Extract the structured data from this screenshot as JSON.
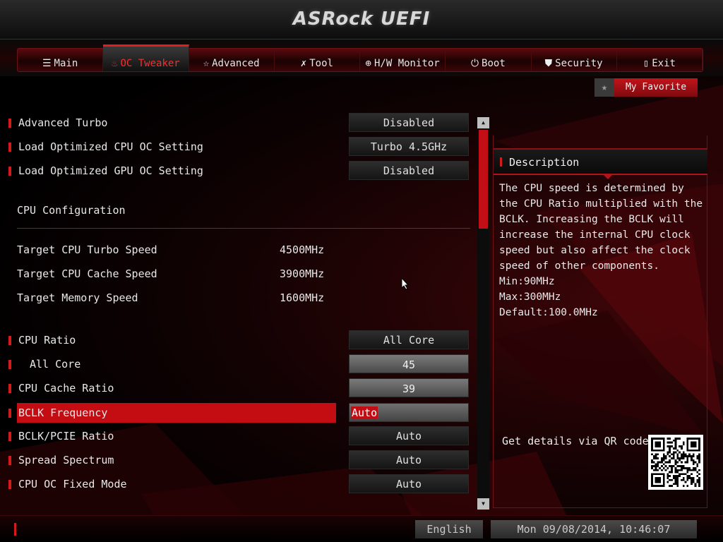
{
  "header": {
    "title": "ASRock UEFI"
  },
  "nav": {
    "tabs": [
      {
        "label": "Main",
        "icon": "list-icon",
        "glyph": "☰",
        "active": false
      },
      {
        "label": "OC Tweaker",
        "icon": "flame-icon",
        "glyph": "♨",
        "active": true
      },
      {
        "label": "Advanced",
        "icon": "star-icon",
        "glyph": "☆",
        "active": false
      },
      {
        "label": "Tool",
        "icon": "tools-icon",
        "glyph": "✗",
        "active": false
      },
      {
        "label": "H/W Monitor",
        "icon": "monitor-icon",
        "glyph": "⊕",
        "active": false
      },
      {
        "label": "Boot",
        "icon": "power-icon",
        "glyph": "⏻",
        "active": false
      },
      {
        "label": "Security",
        "icon": "shield-icon",
        "glyph": "⛊",
        "active": false
      },
      {
        "label": "Exit",
        "icon": "exit-icon",
        "glyph": "▯",
        "active": false
      }
    ]
  },
  "favorite": {
    "label": "My Favorite",
    "icon": "star-icon"
  },
  "settings": {
    "advanced_turbo": {
      "label": "Advanced Turbo",
      "value": "Disabled"
    },
    "load_cpu_oc": {
      "label": "Load Optimized CPU OC Setting",
      "value": "Turbo 4.5GHz"
    },
    "load_gpu_oc": {
      "label": "Load Optimized GPU OC Setting",
      "value": "Disabled"
    },
    "cpu_config_heading": "CPU Configuration",
    "target_turbo": {
      "label": "Target CPU Turbo Speed",
      "value": "4500MHz"
    },
    "target_cache": {
      "label": "Target CPU Cache Speed",
      "value": "3900MHz"
    },
    "target_memory": {
      "label": "Target Memory Speed",
      "value": "1600MHz"
    },
    "cpu_ratio": {
      "label": "CPU Ratio",
      "value": "All Core"
    },
    "all_core": {
      "label": "All Core",
      "value": "45"
    },
    "cache_ratio": {
      "label": "CPU Cache Ratio",
      "value": "39"
    },
    "bclk": {
      "label": "BCLK Frequency",
      "value": "Auto"
    },
    "bclk_pcie": {
      "label": "BCLK/PCIE Ratio",
      "value": "Auto"
    },
    "spread": {
      "label": "Spread Spectrum",
      "value": "Auto"
    },
    "oc_fixed": {
      "label": "CPU OC Fixed Mode",
      "value": "Auto"
    }
  },
  "description": {
    "title": "Description",
    "text": "The CPU speed is determined by the CPU Ratio multiplied with the BCLK. Increasing the BCLK will increase the internal CPU clock speed but also affect the clock speed of other components.",
    "min": "Min:90MHz",
    "max": "Max:300MHz",
    "default": "Default:100.0MHz",
    "qr_label": "Get details via QR code"
  },
  "footer": {
    "language": "English",
    "datetime": "Mon 09/08/2014, 10:46:07"
  },
  "colors": {
    "accent": "#c40d13",
    "panel": "#1a1a1a",
    "text": "#e8e8e8"
  }
}
